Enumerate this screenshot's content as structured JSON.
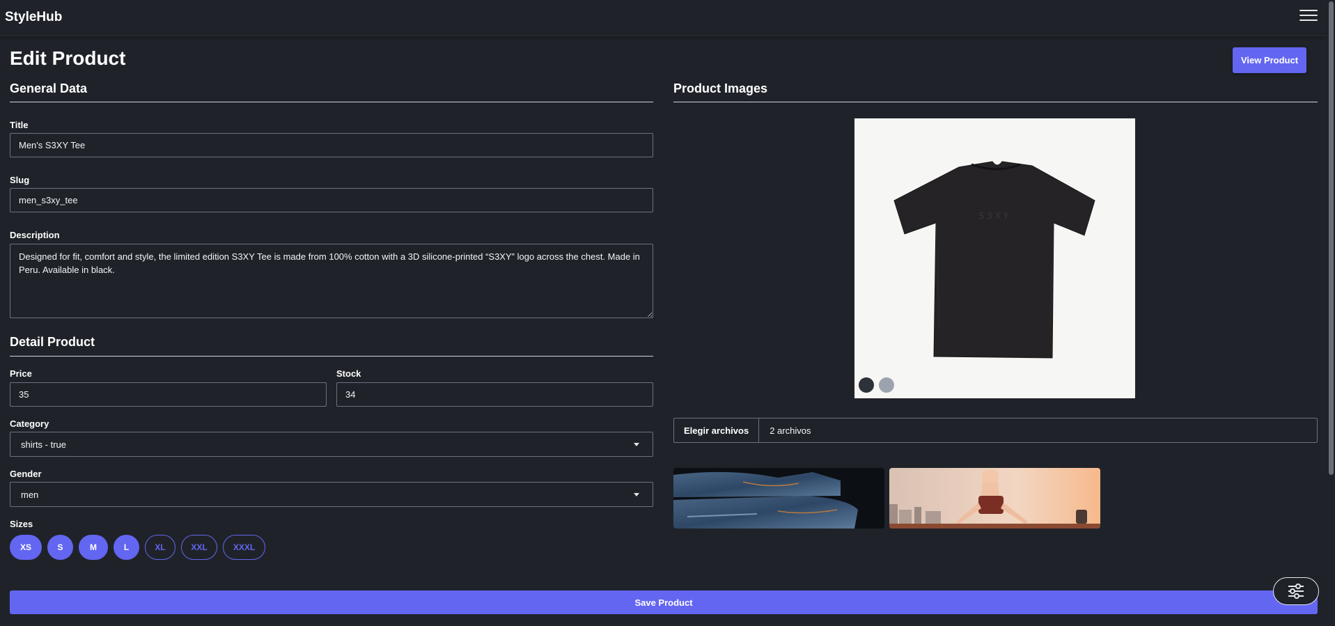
{
  "brand": "StyleHub",
  "page_title": "Edit Product",
  "view_button": "View Product",
  "general": {
    "title": "General Data",
    "title_label": "Title",
    "title_value": "Men's S3XY Tee",
    "slug_label": "Slug",
    "slug_value": "men_s3xy_tee",
    "description_label": "Description",
    "description_value": "Designed for fit, comfort and style, the limited edition S3XY Tee is made from 100% cotton with a 3D silicone-printed “S3XY” logo across the chest. Made in Peru. Available in black."
  },
  "detail": {
    "title": "Detail Product",
    "price_label": "Price",
    "price_value": "35",
    "stock_label": "Stock",
    "stock_value": "34",
    "category_label": "Category",
    "category_value": "shirts - true",
    "gender_label": "Gender",
    "gender_value": "men",
    "sizes_label": "Sizes",
    "sizes": [
      {
        "label": "XS",
        "selected": true
      },
      {
        "label": "S",
        "selected": true
      },
      {
        "label": "M",
        "selected": true
      },
      {
        "label": "L",
        "selected": true
      },
      {
        "label": "XL",
        "selected": false
      },
      {
        "label": "XXL",
        "selected": false
      },
      {
        "label": "XXXL",
        "selected": false
      }
    ]
  },
  "images": {
    "title": "Product Images",
    "shirt_print": "S3XY",
    "file_button": "Elegir archivos",
    "file_count": "2 archivos"
  },
  "save_button": "Save Product",
  "colors": {
    "background": "#1f2329",
    "accent": "#6366f1",
    "border": "#6b7280"
  }
}
